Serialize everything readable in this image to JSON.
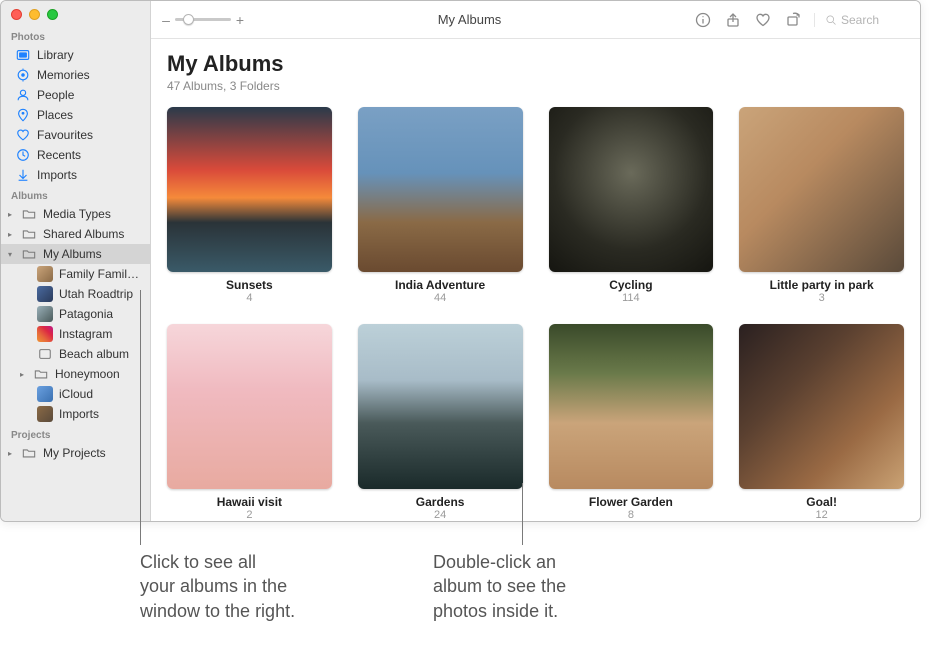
{
  "window": {
    "title": "My Albums"
  },
  "toolbar": {
    "zoom_minus": "–",
    "zoom_plus": "+",
    "search_placeholder": "Search"
  },
  "sidebar": {
    "sections": {
      "photos_label": "Photos",
      "albums_label": "Albums",
      "projects_label": "Projects"
    },
    "photos_items": [
      {
        "id": "library",
        "label": "Library"
      },
      {
        "id": "memories",
        "label": "Memories"
      },
      {
        "id": "people",
        "label": "People"
      },
      {
        "id": "places",
        "label": "Places"
      },
      {
        "id": "favourites",
        "label": "Favourites"
      },
      {
        "id": "recents",
        "label": "Recents"
      },
      {
        "id": "imports",
        "label": "Imports"
      }
    ],
    "albums_items": [
      {
        "id": "media-types",
        "label": "Media Types"
      },
      {
        "id": "shared-albums",
        "label": "Shared Albums"
      },
      {
        "id": "my-albums",
        "label": "My Albums",
        "selected": true
      }
    ],
    "my_albums_children": [
      {
        "id": "family",
        "label": "Family Family…"
      },
      {
        "id": "utah",
        "label": "Utah Roadtrip"
      },
      {
        "id": "patagonia",
        "label": "Patagonia"
      },
      {
        "id": "instagram",
        "label": "Instagram"
      },
      {
        "id": "beach",
        "label": "Beach album"
      },
      {
        "id": "honeymoon",
        "label": "Honeymoon"
      },
      {
        "id": "icloud",
        "label": "iCloud"
      },
      {
        "id": "imports2",
        "label": "Imports"
      }
    ],
    "projects_items": [
      {
        "id": "my-projects",
        "label": "My Projects"
      }
    ]
  },
  "page": {
    "title": "My Albums",
    "subtitle": "47 Albums, 3 Folders"
  },
  "albums": [
    {
      "title": "Sunsets",
      "count": "4",
      "thumb": "t-sunsets"
    },
    {
      "title": "India Adventure",
      "count": "44",
      "thumb": "t-india"
    },
    {
      "title": "Cycling",
      "count": "114",
      "thumb": "t-cycling"
    },
    {
      "title": "Little party in park",
      "count": "3",
      "thumb": "t-party"
    },
    {
      "title": "Hawaii visit",
      "count": "2",
      "thumb": "t-hawaii"
    },
    {
      "title": "Gardens",
      "count": "24",
      "thumb": "t-gardens"
    },
    {
      "title": "Flower Garden",
      "count": "8",
      "thumb": "t-flower"
    },
    {
      "title": "Goal!",
      "count": "12",
      "thumb": "t-goal"
    }
  ],
  "callouts": {
    "left": "Click to see all\nyour albums in the\nwindow to the right.",
    "right": "Double-click an\nalbum to see the\nphotos inside it."
  }
}
